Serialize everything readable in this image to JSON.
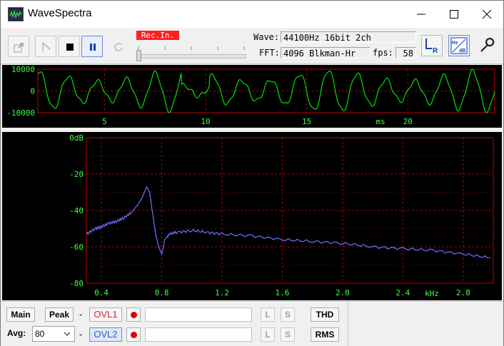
{
  "window": {
    "title": "WaveSpectra"
  },
  "toolbar": {
    "rec_in": "Rec.In.",
    "wave_label": "Wave:",
    "wave_value": "44100Hz 16bit 2ch",
    "fft_label": "FFT:",
    "fft_value": "4096 Blkman-Hr",
    "fps_label": "fps:",
    "fps_value": "58",
    "slider_position": 0.0
  },
  "wave_chart": {
    "y_ticks": [
      "10000",
      "0",
      "-10000"
    ],
    "x_ticks": [
      "5",
      "10",
      "15",
      "20"
    ],
    "x_unit": "ms"
  },
  "spectrum_chart": {
    "y_ticks": [
      "0dB",
      "-20",
      "-40",
      "-60",
      "-80"
    ],
    "x_ticks": [
      "0.4",
      "0.8",
      "1.2",
      "1.6",
      "2.0",
      "2.4",
      "2.8"
    ],
    "x_unit": "kHz"
  },
  "chart_data": [
    {
      "type": "line",
      "name": "waveform",
      "xlabel": "ms",
      "ylabel": "",
      "xlim": [
        1.7,
        24.3
      ],
      "ylim": [
        -10000,
        10000
      ],
      "x_ticks": [
        5,
        10,
        15,
        20
      ],
      "y_ticks": [
        10000,
        0,
        -10000
      ],
      "grid": true,
      "series": [
        {
          "color": "#00e000",
          "frequency_hz": 700,
          "amplitude": 7000,
          "peak_amplitude": 10000
        }
      ]
    },
    {
      "type": "line",
      "name": "spectrum",
      "xlabel": "kHz",
      "ylabel": "dB",
      "xlim": [
        0.3,
        3.0
      ],
      "ylim": [
        -80,
        0
      ],
      "x_ticks": [
        0.4,
        0.8,
        1.2,
        1.6,
        2.0,
        2.4,
        2.8
      ],
      "y_ticks": [
        0,
        -20,
        -40,
        -60,
        -80
      ],
      "grid": true,
      "series": [
        {
          "color": "#7070ff",
          "x": [
            0.3,
            0.36,
            0.4,
            0.45,
            0.5,
            0.55,
            0.6,
            0.64,
            0.67,
            0.7,
            0.72,
            0.74,
            0.76,
            0.78,
            0.8,
            0.82,
            0.85,
            0.9,
            1.0,
            1.1,
            1.2,
            1.4,
            1.6,
            1.8,
            2.0,
            2.2,
            2.4,
            2.6,
            2.8,
            2.98
          ],
          "y": [
            -53,
            -50,
            -49,
            -47,
            -46,
            -44,
            -41,
            -37,
            -33,
            -27,
            -30,
            -42,
            -53,
            -60,
            -64,
            -56,
            -53,
            -52,
            -51,
            -52,
            -53,
            -54,
            -56,
            -57,
            -58,
            -60,
            -61,
            -62,
            -64,
            -66
          ]
        }
      ]
    }
  ],
  "bottom": {
    "main_label": "Main",
    "peak_label": "Peak",
    "avg_label": "Avg:",
    "avg_value": "80",
    "ovl1_label": "OVL1",
    "ovl2_label": "OVL2",
    "dash": "-",
    "l_label": "L",
    "s_label": "S",
    "thd_label": "THD",
    "rms_label": "RMS"
  }
}
